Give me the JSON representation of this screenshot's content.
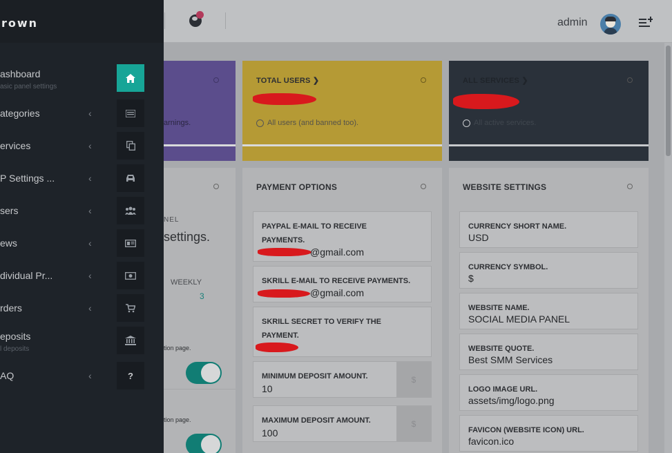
{
  "header": {
    "user_name": "admin",
    "globe_icon": "globe-icon",
    "avatar_icon": "user-avatar-icon",
    "menu_icon": "playlist-add-icon"
  },
  "sidebar": {
    "brand": "rown",
    "items": [
      {
        "label": "ashboard",
        "sub": "asic panel settings",
        "icon": "home-icon"
      },
      {
        "label": "ategories",
        "chevron": "‹",
        "icon": "list-icon"
      },
      {
        "label": "ervices",
        "chevron": "‹",
        "icon": "copy-icon"
      },
      {
        "label": "P Settings ...",
        "chevron": "‹",
        "icon": "car-icon"
      },
      {
        "label": "sers",
        "chevron": "‹",
        "icon": "users-icon"
      },
      {
        "label": "ews",
        "chevron": "‹",
        "icon": "newspaper-icon"
      },
      {
        "label": "dividual Pr...",
        "chevron": "‹",
        "icon": "money-icon"
      },
      {
        "label": "rders",
        "chevron": "‹",
        "icon": "cart-icon"
      },
      {
        "label": "eposits",
        "sub": "l deposits",
        "icon": "bank-icon"
      },
      {
        "label": "AQ",
        "chevron": "‹",
        "icon": "question-icon"
      }
    ]
  },
  "stats": {
    "earnings_sub": "arnings.",
    "total_users_title": "TOTAL USERS",
    "total_users_sub": "All users (and banned too).",
    "all_services_title": "ALL SERVICES",
    "all_services_sub": "All active services."
  },
  "partial_panel": {
    "label_nel": "NEL",
    "settings_text": "settings.",
    "weekly_label": "WEEKLY",
    "weekly_value": "3",
    "option_page_1": "tion page.",
    "option_page_2": "tion page."
  },
  "payment_options": {
    "title": "PAYMENT OPTIONS",
    "fields": [
      {
        "label": "PAYPAL E-MAIL TO RECEIVE PAYMENTS.",
        "value": "@gmail.com"
      },
      {
        "label": "SKRILL E-MAIL TO RECEIVE PAYMENTS.",
        "value": "@gmail.com"
      },
      {
        "label": "SKRILL SECRET TO VERIFY THE PAYMENT.",
        "value": ""
      },
      {
        "label": "MINIMUM DEPOSIT AMOUNT.",
        "value": "10",
        "addon": "$"
      },
      {
        "label": "MAXIMUM DEPOSIT AMOUNT.",
        "value": "100",
        "addon": "$"
      }
    ]
  },
  "website_settings": {
    "title": "WEBSITE SETTINGS",
    "fields": [
      {
        "label": "CURRENCY SHORT NAME.",
        "value": "USD"
      },
      {
        "label": "CURRENCY SYMBOL.",
        "value": "$"
      },
      {
        "label": "WEBSITE NAME.",
        "value": "SOCIAL MEDIA PANEL"
      },
      {
        "label": "WEBSITE QUOTE.",
        "value": "Best SMM Services"
      },
      {
        "label": "LOGO IMAGE URL.",
        "value": "assets/img/logo.png"
      },
      {
        "label": "FAVICON (WEBSITE ICON) URL.",
        "value": "favicon.ico"
      }
    ]
  },
  "colors": {
    "sidebar_bg": "#1e2329",
    "accent_teal": "#17a597",
    "purple_card": "#5b4d8c",
    "yellow_card": "#b59a35",
    "dark_card": "#2a313a",
    "redaction": "#d8191d"
  }
}
